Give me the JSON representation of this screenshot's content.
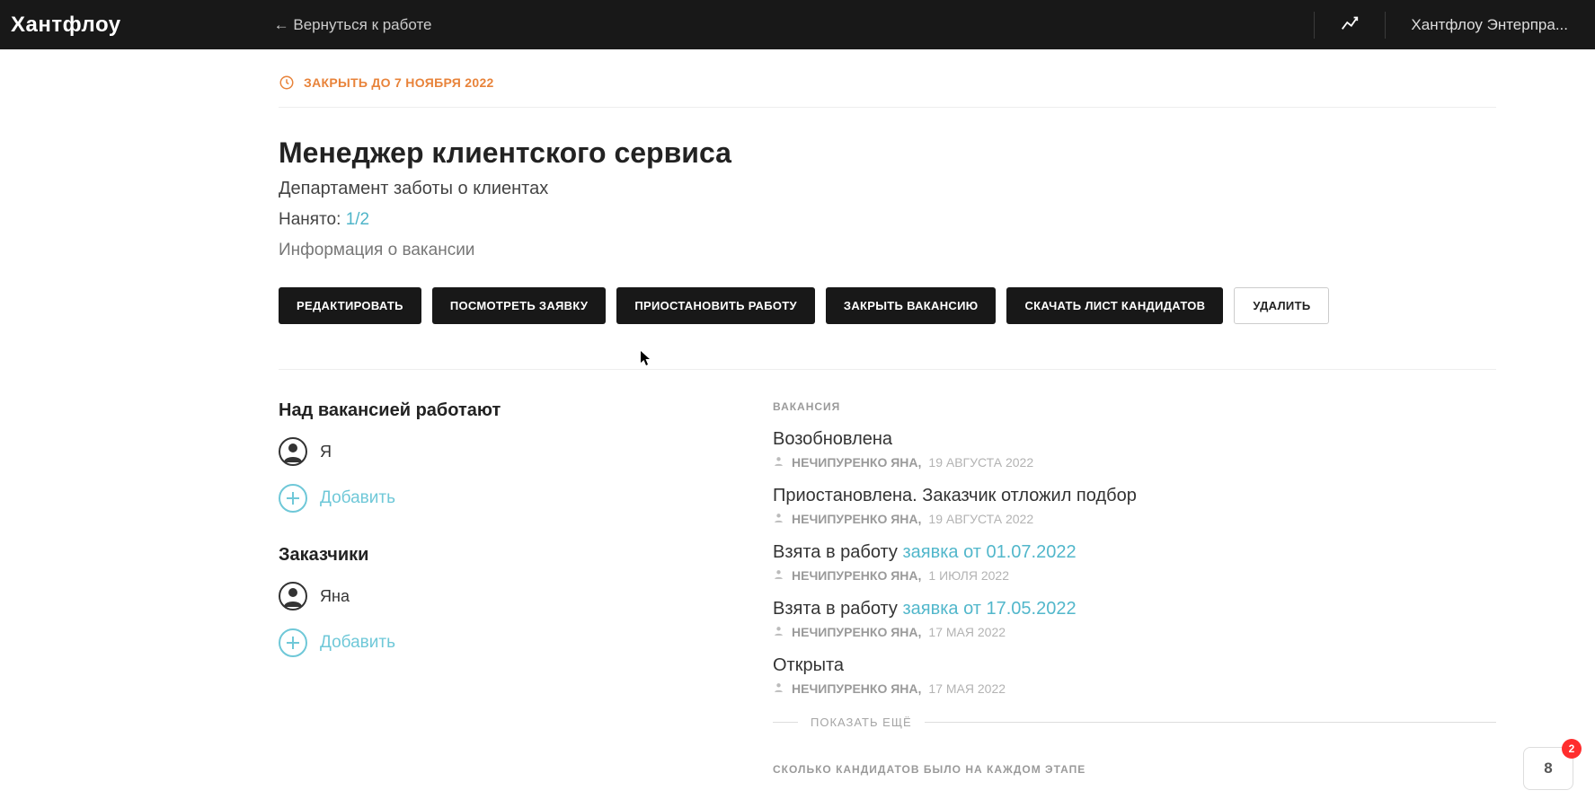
{
  "header": {
    "logo": "Хантфлоу",
    "back": "← Вернуться к работе",
    "company": "Хантфлоу Энтерпра..."
  },
  "deadline": {
    "text": "ЗАКРЫТЬ ДО 7 НОЯБРЯ 2022"
  },
  "vacancy": {
    "title": "Менеджер клиентского сервиса",
    "department": "Департамент заботы о клиентах",
    "hired_label": "Нанято:",
    "hired_value": "1/2",
    "info_link": "Информация о вакансии"
  },
  "actions": {
    "edit": "РЕДАКТИРОВАТЬ",
    "view_request": "ПОСМОТРЕТЬ ЗАЯВКУ",
    "pause": "ПРИОСТАНОВИТЬ РАБОТУ",
    "close": "ЗАКРЫТЬ ВАКАНСИЮ",
    "download": "СКАЧАТЬ ЛИСТ КАНДИДАТОВ",
    "delete": "УДАЛИТЬ"
  },
  "working": {
    "title": "Над вакансией работают",
    "me": "Я",
    "add": "Добавить"
  },
  "customers": {
    "title": "Заказчики",
    "name": "Яна",
    "add": "Добавить"
  },
  "feed": {
    "label": "ВАКАНСИЯ",
    "items": [
      {
        "title": "Возобновлена",
        "link": "",
        "user": "НЕЧИПУРЕНКО ЯНА,",
        "date": "19 АВГУСТА 2022"
      },
      {
        "title": "Приостановлена. Заказчик отложил подбор",
        "link": "",
        "user": "НЕЧИПУРЕНКО ЯНА,",
        "date": "19 АВГУСТА 2022"
      },
      {
        "title": "Взята в работу",
        "link": "заявка от 01.07.2022",
        "user": "НЕЧИПУРЕНКО ЯНА,",
        "date": "1 ИЮЛЯ 2022"
      },
      {
        "title": "Взята в работу",
        "link": "заявка от 17.05.2022",
        "user": "НЕЧИПУРЕНКО ЯНА,",
        "date": "17 МАЯ 2022"
      },
      {
        "title": "Открыта",
        "link": "",
        "user": "НЕЧИПУРЕНКО ЯНА,",
        "date": "17 МАЯ 2022"
      }
    ],
    "show_more": "ПОКАЗАТЬ ЕЩЁ",
    "stage_label": "СКОЛЬКО КАНДИДАТОВ БЫЛО НА КАЖДОМ ЭТАПЕ"
  },
  "notif": {
    "count": "8",
    "badge": "2"
  }
}
